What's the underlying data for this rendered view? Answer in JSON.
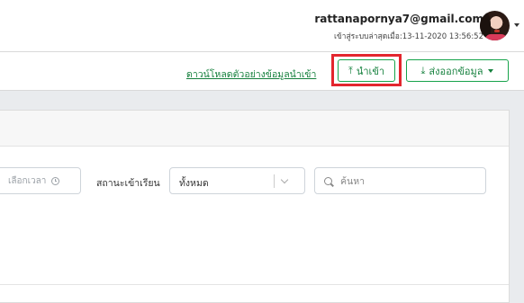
{
  "header": {
    "email": "rattanapornya7@gmail.com",
    "last_login": "เข้าสู่ระบบล่าสุดเมื่อ:13-11-2020 13:56:52",
    "avatar_icon": "user-avatar",
    "menu_icon": "chevron-down-icon"
  },
  "actions": {
    "download_sample": "ดาวน์โหลดตัวอย่างข้อมูลนำเข้า",
    "import_label": "นำเข้า",
    "import_icon": "upload-icon",
    "export_label": "ส่งออกข้อมูล",
    "export_icon": "download-icon",
    "highlight_color": "#e3262e",
    "accent_color": "#15803d"
  },
  "filters": {
    "time_placeholder": "เลือกเวลา",
    "status_label": "สถานะเข้าเรียน",
    "status_value": "ทั้งหมด",
    "search_placeholder": "ค้นหา"
  }
}
